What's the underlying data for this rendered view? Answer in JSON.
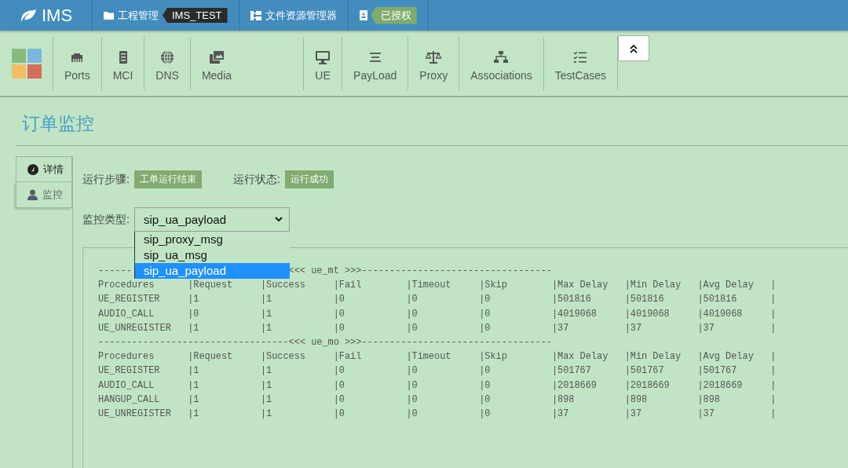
{
  "topbar": {
    "brand": "IMS",
    "items": [
      {
        "kind": "project",
        "label": "工程管理",
        "tag": "IMS_TEST"
      },
      {
        "kind": "explorer",
        "label": "文件资源管理器"
      },
      {
        "kind": "license",
        "tag": "已授权"
      }
    ]
  },
  "toolbar": {
    "groups": [
      [
        {
          "label": "Ports"
        },
        {
          "label": "MCI"
        },
        {
          "label": "DNS"
        },
        {
          "label": "Media"
        }
      ],
      [
        {
          "label": "UE"
        },
        {
          "label": "PayLoad"
        },
        {
          "label": "Proxy"
        },
        {
          "label": "Associations"
        },
        {
          "label": "TestCases"
        }
      ]
    ]
  },
  "page_title": "订单监控",
  "side_tabs": [
    {
      "label": "详情",
      "selected": false
    },
    {
      "label": "监控",
      "selected": true
    }
  ],
  "status": [
    {
      "label": "运行步骤:",
      "badge": "工单运行结束"
    },
    {
      "label": "运行状态:",
      "badge": "运行成功"
    }
  ],
  "monitor_type": {
    "label": "监控类型:",
    "value": "sip_ua_payload",
    "options": [
      {
        "label": "sip_proxy_msg",
        "selected": false
      },
      {
        "label": "sip_ua_msg",
        "selected": false
      },
      {
        "label": "sip_ua_payload",
        "selected": true
      }
    ]
  },
  "report": {
    "sections": [
      {
        "separator": [
          "------",
          "<<< ue_mt >>>----------------------------------"
        ],
        "header": [
          "Procedures",
          "|Request",
          "|Success",
          "|Fail",
          "|Timeout",
          "|Skip",
          "|Max Delay",
          "|Min Delay",
          "|Avg Delay",
          "|"
        ],
        "rows": [
          [
            "UE_REGISTER",
            "|1",
            "|1",
            "|0",
            "|0",
            "|0",
            "|501816",
            "|501816",
            "|501816",
            "|"
          ],
          [
            "AUDIO_CALL",
            "|0",
            "|1",
            "|0",
            "|0",
            "|0",
            "|4019068",
            "|4019068",
            "|4019068",
            "|"
          ],
          [
            "UE_UNREGISTER",
            "|1",
            "|1",
            "|0",
            "|0",
            "|0",
            "|37",
            "|37",
            "|37",
            "|"
          ]
        ]
      },
      {
        "separator": [
          "----------------------------------<<< ue_mo >>>----------------------------------"
        ],
        "header": [
          "Procedures",
          "|Request",
          "|Success",
          "|Fail",
          "|Timeout",
          "|Skip",
          "|Max Delay",
          "|Min Delay",
          "|Avg Delay",
          "|"
        ],
        "rows": [
          [
            "UE_REGISTER",
            "|1",
            "|1",
            "|0",
            "|0",
            "|0",
            "|501767",
            "|501767",
            "|501767",
            "|"
          ],
          [
            "AUDIO_CALL",
            "|1",
            "|1",
            "|0",
            "|0",
            "|0",
            "|2018669",
            "|2018669",
            "|2018669",
            "|"
          ],
          [
            "HANGUP_CALL",
            "|1",
            "|1",
            "|0",
            "|0",
            "|0",
            "|898",
            "|898",
            "|898",
            "|"
          ],
          [
            "UE_UNREGISTER",
            "|1",
            "|1",
            "|0",
            "|0",
            "|0",
            "|37",
            "|37",
            "|37",
            "|"
          ]
        ]
      }
    ]
  }
}
